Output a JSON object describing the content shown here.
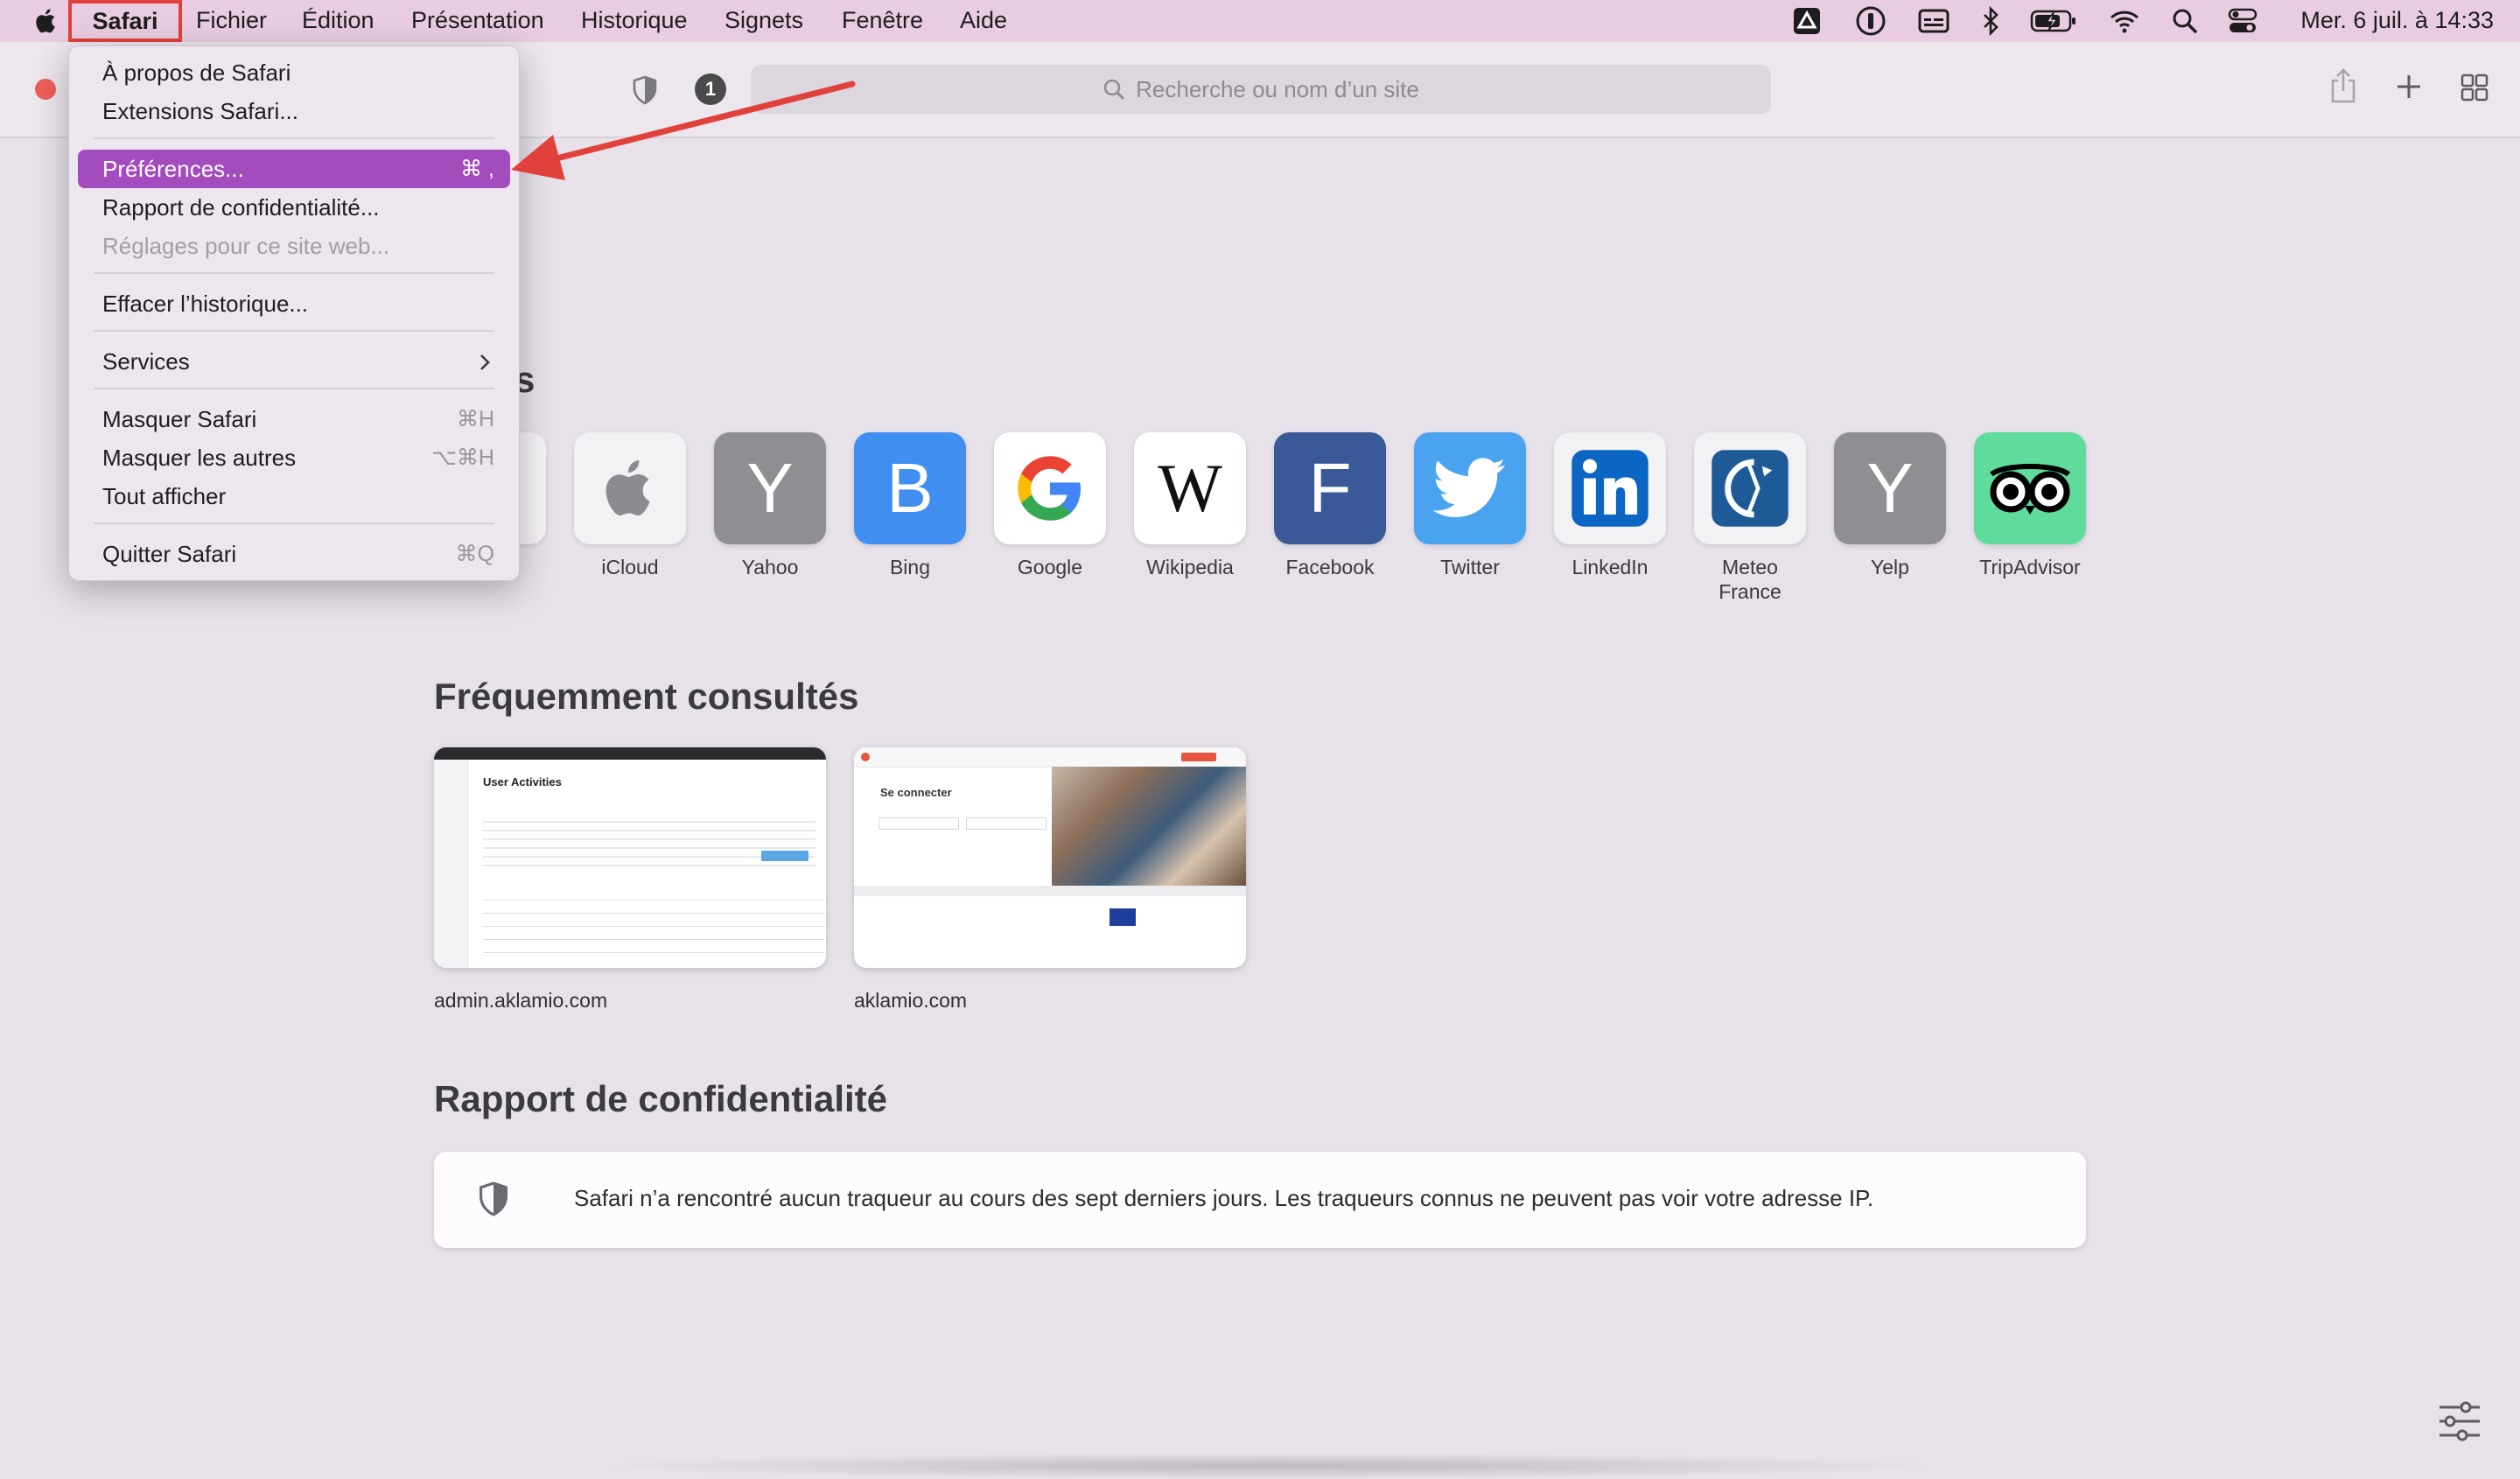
{
  "menubar": {
    "items": [
      "Safari",
      "Fichier",
      "Édition",
      "Présentation",
      "Historique",
      "Signets",
      "Fenêtre",
      "Aide"
    ],
    "clock": "Mer. 6 juil. à  14:33",
    "status_icons": [
      "drive-icon",
      "onepassword-icon",
      "caption-icon",
      "bluetooth-icon",
      "battery-charging-icon",
      "wifi-icon",
      "search-icon",
      "control-center-icon"
    ]
  },
  "toolbar": {
    "tab_count": "1",
    "search_placeholder": "Recherche ou nom d’un site"
  },
  "safari_menu": {
    "items": [
      {
        "label": "À propos de Safari",
        "shortcut": ""
      },
      {
        "label": "Extensions Safari...",
        "shortcut": ""
      },
      {
        "label": "Préférences...",
        "shortcut": "⌘ ,",
        "state": "highlighted"
      },
      {
        "label": "Rapport de confidentialité...",
        "shortcut": ""
      },
      {
        "label": "Réglages pour ce site web...",
        "shortcut": "",
        "state": "disabled"
      },
      {
        "label": "Effacer l’historique...",
        "shortcut": ""
      },
      {
        "label": "Services",
        "shortcut": "",
        "submenu": true
      },
      {
        "label": "Masquer Safari",
        "shortcut": "⌘H"
      },
      {
        "label": "Masquer les autres",
        "shortcut": "⌥⌘H"
      },
      {
        "label": "Tout afficher",
        "shortcut": ""
      },
      {
        "label": "Quitter Safari",
        "shortcut": "⌘Q"
      }
    ]
  },
  "favorites": {
    "title_fragment": "ris",
    "items": [
      {
        "label": "iCloud",
        "glyph": "",
        "color": "#f2f2f4"
      },
      {
        "label": "Yahoo",
        "glyph": "Y",
        "color": "#8e8e93"
      },
      {
        "label": "Bing",
        "glyph": "B",
        "color": "#3f8ef0"
      },
      {
        "label": "Google",
        "glyph": "G",
        "color": "#ffffff"
      },
      {
        "label": "Wikipedia",
        "glyph": "W",
        "color": "#ffffff"
      },
      {
        "label": "Facebook",
        "glyph": "F",
        "color": "#3b5998"
      },
      {
        "label": "Twitter",
        "glyph": "",
        "color": "#4aa3ee"
      },
      {
        "label": "LinkedIn",
        "glyph": "in",
        "color": "#f2f2f4"
      },
      {
        "label": "Meteo\nFrance",
        "glyph": "",
        "color": "#f2f2f4"
      },
      {
        "label": "Yelp",
        "glyph": "Y",
        "color": "#8e8e93"
      },
      {
        "label": "TripAdvisor",
        "glyph": "",
        "color": "#5fdc9b"
      }
    ]
  },
  "frequent": {
    "title": "Fréquemment consultés",
    "items": [
      {
        "label": "admin.aklamio.com",
        "thumb_title": "User Activities"
      },
      {
        "label": "aklamio.com",
        "thumb_title": "Se connecter"
      }
    ]
  },
  "privacy": {
    "title": "Rapport de confidentialité",
    "text": "Safari n’a rencontré aucun traqueur au cours des sept derniers jours. Les traqueurs connus ne peuvent pas voir votre adresse IP."
  },
  "colors": {
    "menu_highlight": "#a24cbd",
    "annotation_red": "#e0413a"
  }
}
